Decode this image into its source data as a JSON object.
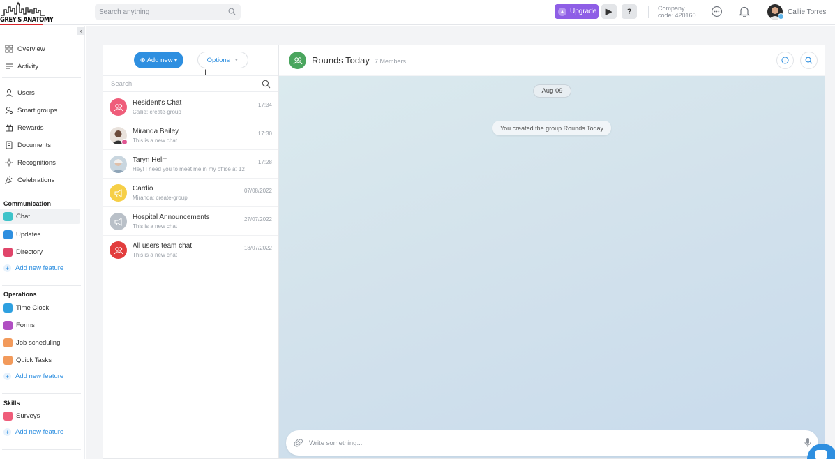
{
  "app": {
    "logo_text": "GREY'S ANATOMY",
    "search_placeholder": "Search anything",
    "upgrade_label": "Upgrade",
    "help_label": "?",
    "company_label": "Company",
    "company_code": "code: 420160",
    "user_name": "Callie Torres",
    "accent_color": "#2e8fe0",
    "upgrade_color": "#8e5ee6"
  },
  "sidebar": {
    "items": [
      {
        "label": "Overview",
        "icon": "grid-icon"
      },
      {
        "label": "Activity",
        "icon": "menu-lines-icon"
      },
      {
        "label": "Users",
        "icon": "user-icon"
      },
      {
        "label": "Smart groups",
        "icon": "user-search-icon"
      },
      {
        "label": "Rewards",
        "icon": "gift-icon"
      },
      {
        "label": "Documents",
        "icon": "document-icon"
      },
      {
        "label": "Recognitions",
        "icon": "sparkle-icon"
      },
      {
        "label": "Celebrations",
        "icon": "party-icon"
      }
    ],
    "communication": {
      "title": "Communication",
      "items": [
        {
          "label": "Chat",
          "color": "#3ec3c9"
        },
        {
          "label": "Updates",
          "color": "#2e8fe0"
        },
        {
          "label": "Directory",
          "color": "#e0456a"
        }
      ],
      "add_label": "Add new feature"
    },
    "operations": {
      "title": "Operations",
      "items": [
        {
          "label": "Time Clock",
          "color": "#2ea0e0"
        },
        {
          "label": "Forms",
          "color": "#b04fc2"
        },
        {
          "label": "Job scheduling",
          "color": "#f29a5b"
        },
        {
          "label": "Quick Tasks",
          "color": "#f29a5b"
        }
      ],
      "add_label": "Add new feature"
    },
    "skills": {
      "title": "Skills",
      "items": [
        {
          "label": "Surveys",
          "color": "#ef5d7a"
        }
      ],
      "add_label": "Add new feature"
    }
  },
  "chat_list": {
    "add_new_label": "Add new",
    "options_label": "Options",
    "search_placeholder": "Search",
    "chats": [
      {
        "name": "Resident's Chat",
        "preview": "Callie: create-group",
        "time": "17:34",
        "color": "#ef5d7a"
      },
      {
        "name": "Miranda Bailey",
        "preview": "This is a new chat",
        "time": "17:30",
        "color": "#444444"
      },
      {
        "name": "Taryn Helm",
        "preview": "Hey! I need you to meet me in my office at 12",
        "time": "17:28",
        "color": "#9fb3c4"
      },
      {
        "name": "Cardio",
        "preview": "Miranda: create-group",
        "time": "07/08/2022",
        "color": "#f6cf47"
      },
      {
        "name": "Hospital Announcements",
        "preview": "This is a new chat",
        "time": "27/07/2022",
        "color": "#b9c0c8"
      },
      {
        "name": "All users team chat",
        "preview": "This is a new chat",
        "time": "18/07/2022",
        "color": "#e23d3d"
      }
    ]
  },
  "conversation": {
    "title": "Rounds Today",
    "members": "7 Members",
    "date_pill": "Aug 09",
    "system_message": "You created the group Rounds Today",
    "composer_placeholder": "Write something..."
  }
}
